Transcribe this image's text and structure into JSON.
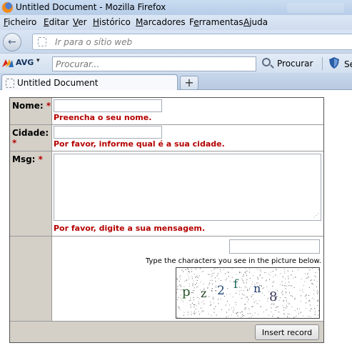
{
  "window": {
    "title": "Untitled Document - Mozilla Firefox"
  },
  "menu": [
    {
      "label": "Ficheiro",
      "accel": "F"
    },
    {
      "label": "Editar",
      "accel": "E"
    },
    {
      "label": "Ver",
      "accel": "V"
    },
    {
      "label": "Histórico",
      "accel": "H"
    },
    {
      "label": "Marcadores",
      "accel": "M"
    },
    {
      "label": "Ferramentas",
      "accel": "F"
    },
    {
      "label": "Ajuda",
      "accel": "A"
    }
  ],
  "navbar": {
    "url_placeholder": "Ir para o sítio web"
  },
  "avg_toolbar": {
    "brand": "AVG",
    "search_placeholder": "Procurar...",
    "search_button": "Procurar",
    "truncated_button": "Se"
  },
  "tab": {
    "title": "Untitled Document",
    "new_tab": "+"
  },
  "form": {
    "nome": {
      "label": "Nome:",
      "required_mark": "*",
      "value": "",
      "error": "Preencha o seu nome."
    },
    "cidade": {
      "label": "Cidade:",
      "required_mark": "*",
      "value": "",
      "error": "Por favor, informe qual é a sua cidade."
    },
    "msg": {
      "label": "Msg:",
      "required_mark": "*",
      "value": "",
      "error": "Por favor, digite a sua mensagem."
    },
    "captcha": {
      "value": "",
      "hint": "Type the characters you see in the picture below.",
      "chars": [
        "p",
        "z",
        "2",
        "f",
        "n",
        "8"
      ]
    },
    "submit_label": "Insert record"
  },
  "colors": {
    "error_red": "#b50000",
    "label_cell_bg": "#d4d0c8",
    "chrome_blue": "#c9dcf1"
  }
}
